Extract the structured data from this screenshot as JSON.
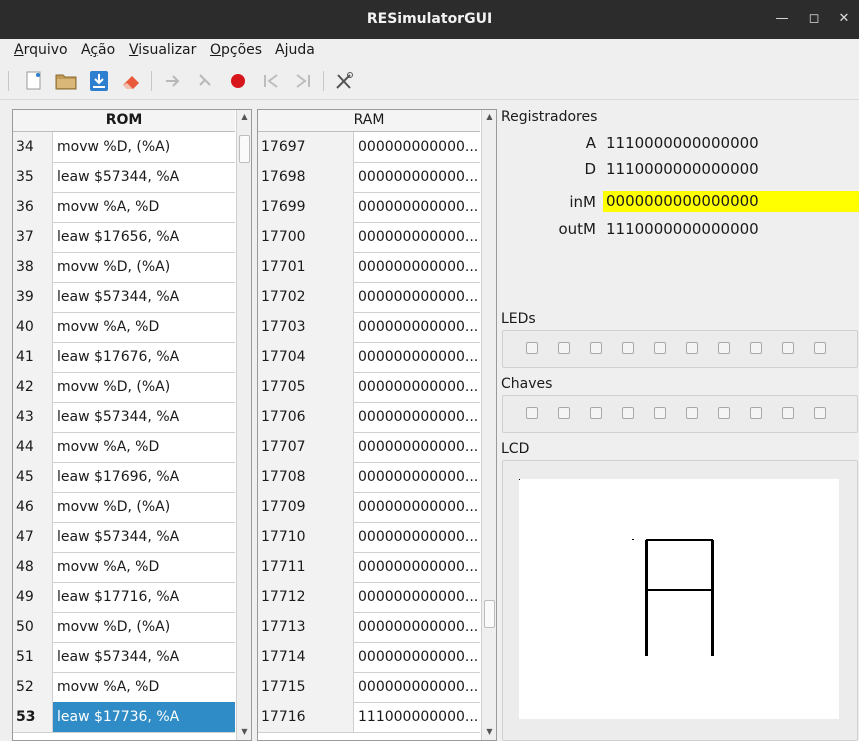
{
  "window": {
    "title": "RESimulatorGUI"
  },
  "menu": [
    {
      "label": "Arquivo",
      "mnemonic": "A",
      "rest": "rquivo"
    },
    {
      "label": "Ação",
      "mnemonic": "ç",
      "rest_pre": "A",
      "rest_post": "ão"
    },
    {
      "label": "Visualizar",
      "mnemonic": "V",
      "rest": "isualizar"
    },
    {
      "label": "Opções",
      "mnemonic": "O",
      "rest": "pções"
    },
    {
      "label": "Ajuda",
      "mnemonic": "j",
      "rest_pre": "A",
      "rest_post": "uda"
    }
  ],
  "toolbar": {
    "icons": [
      "new-file-icon",
      "open-folder-icon",
      "save-download-icon",
      "eraser-icon",
      "step-forward-icon",
      "step-into-icon",
      "stop-record-icon",
      "skip-back-icon",
      "skip-forward-icon",
      "tools-icon"
    ],
    "colors": {
      "red": "#d6161b",
      "blue": "#2f7fd0",
      "folder": "#c29a55",
      "eraser": "#e85a3a"
    }
  },
  "rom": {
    "header": "ROM",
    "rows": [
      {
        "n": "34",
        "v": "movw %D, (%A)"
      },
      {
        "n": "35",
        "v": "leaw $57344, %A"
      },
      {
        "n": "36",
        "v": "movw %A, %D"
      },
      {
        "n": "37",
        "v": "leaw $17656, %A"
      },
      {
        "n": "38",
        "v": "movw %D, (%A)"
      },
      {
        "n": "39",
        "v": "leaw $57344, %A"
      },
      {
        "n": "40",
        "v": "movw %A, %D"
      },
      {
        "n": "41",
        "v": "leaw $17676, %A"
      },
      {
        "n": "42",
        "v": "movw %D, (%A)"
      },
      {
        "n": "43",
        "v": "leaw $57344, %A"
      },
      {
        "n": "44",
        "v": "movw %A, %D"
      },
      {
        "n": "45",
        "v": "leaw $17696, %A"
      },
      {
        "n": "46",
        "v": "movw %D, (%A)"
      },
      {
        "n": "47",
        "v": "leaw $57344, %A"
      },
      {
        "n": "48",
        "v": "movw %A, %D"
      },
      {
        "n": "49",
        "v": "leaw $17716, %A"
      },
      {
        "n": "50",
        "v": "movw %D, (%A)"
      },
      {
        "n": "51",
        "v": "leaw $57344, %A"
      },
      {
        "n": "52",
        "v": "movw %A, %D"
      },
      {
        "n": "53",
        "v": "leaw $17736, %A"
      }
    ],
    "selected_index": 19
  },
  "ram": {
    "header": "RAM",
    "rows": [
      {
        "n": "17697",
        "v": "000000000000..."
      },
      {
        "n": "17698",
        "v": "000000000000..."
      },
      {
        "n": "17699",
        "v": "000000000000..."
      },
      {
        "n": "17700",
        "v": "000000000000..."
      },
      {
        "n": "17701",
        "v": "000000000000..."
      },
      {
        "n": "17702",
        "v": "000000000000..."
      },
      {
        "n": "17703",
        "v": "000000000000..."
      },
      {
        "n": "17704",
        "v": "000000000000..."
      },
      {
        "n": "17705",
        "v": "000000000000..."
      },
      {
        "n": "17706",
        "v": "000000000000..."
      },
      {
        "n": "17707",
        "v": "000000000000..."
      },
      {
        "n": "17708",
        "v": "000000000000..."
      },
      {
        "n": "17709",
        "v": "000000000000..."
      },
      {
        "n": "17710",
        "v": "000000000000..."
      },
      {
        "n": "17711",
        "v": "000000000000..."
      },
      {
        "n": "17712",
        "v": "000000000000..."
      },
      {
        "n": "17713",
        "v": "000000000000..."
      },
      {
        "n": "17714",
        "v": "000000000000..."
      },
      {
        "n": "17715",
        "v": "000000000000..."
      },
      {
        "n": "17716",
        "v": "111000000000..."
      }
    ]
  },
  "registers": {
    "title": "Registradores",
    "A": {
      "label": "A",
      "value": "1110000000000000"
    },
    "D": {
      "label": "D",
      "value": "1110000000000000"
    },
    "inM": {
      "label": "inM",
      "value": "0000000000000000"
    },
    "outM": {
      "label": "outM",
      "value": "1110000000000000"
    },
    "highlight_color": "#ffff00"
  },
  "leds": {
    "title": "LEDs",
    "count": 10
  },
  "switches": {
    "title": "Chaves",
    "count": 10
  },
  "lcd": {
    "title": "LCD"
  }
}
